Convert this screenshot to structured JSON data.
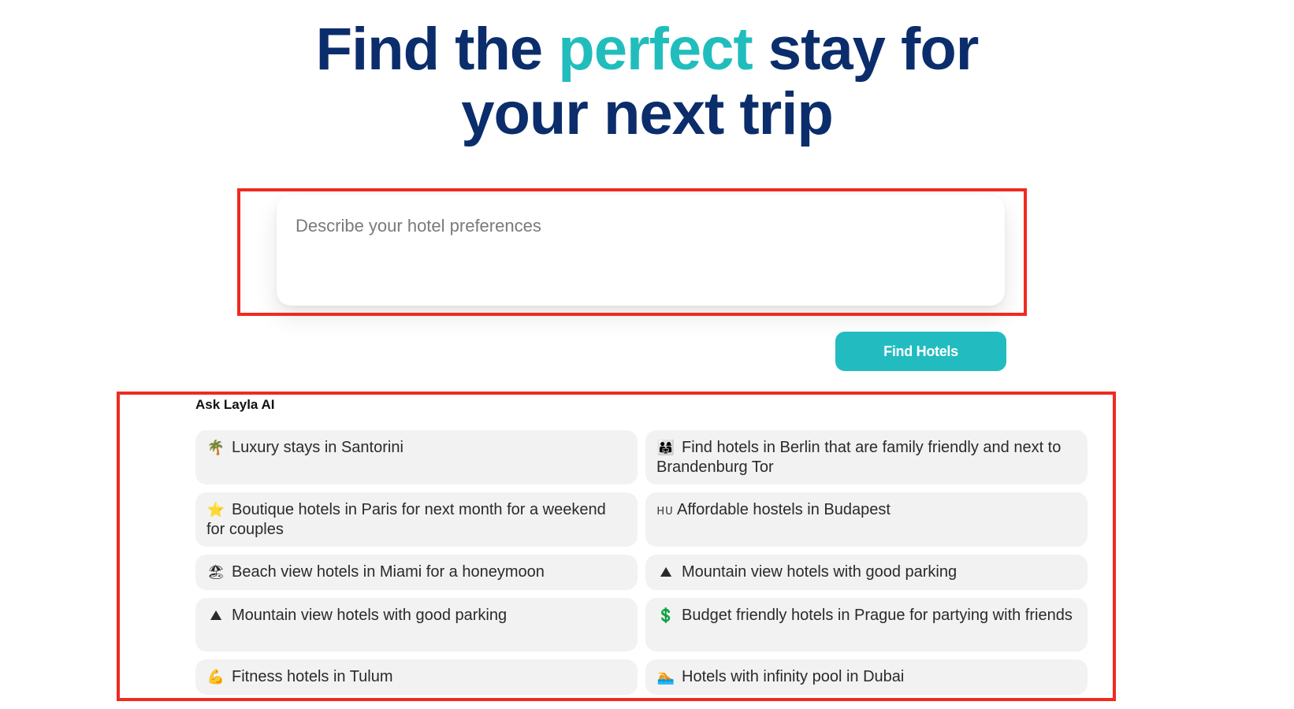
{
  "hero": {
    "line1_pre": "Find the ",
    "line1_accent": "perfect",
    "line1_post": " stay for",
    "line2": "your next trip"
  },
  "search": {
    "placeholder": "Describe your hotel preferences",
    "value": ""
  },
  "find_button": {
    "label": "Find Hotels"
  },
  "suggestions": {
    "label": "Ask Layla AI",
    "items": [
      {
        "icon": "🌴",
        "icon_name": "palm-tree-icon",
        "text": "Luxury stays in Santorini"
      },
      {
        "icon": "👨‍👩‍👧",
        "icon_name": "family-icon",
        "text": "Find hotels in Berlin that are family friendly and next to Brandenburg Tor"
      },
      {
        "icon": "⭐",
        "icon_name": "star-icon",
        "text": "Boutique hotels in Paris for next month for a weekend for couples"
      },
      {
        "icon": "HU",
        "icon_name": "hungary-flag-icon",
        "text": "Affordable hostels in Budapest"
      },
      {
        "icon": "🏖",
        "icon_name": "beach-icon",
        "text": "Beach view hotels in Miami for a honeymoon"
      },
      {
        "icon": "⛰",
        "icon_name": "mountain-icon",
        "text": "Mountain view hotels with good parking"
      },
      {
        "icon": "⛰",
        "icon_name": "mountain-icon",
        "text": "Mountain view hotels with good parking"
      },
      {
        "icon": "💲",
        "icon_name": "dollar-icon",
        "text": "Budget friendly hotels in Prague for partying with friends"
      },
      {
        "icon": "💪",
        "icon_name": "flexed-biceps-icon",
        "text": "Fitness hotels in Tulum"
      },
      {
        "icon": "🏊",
        "icon_name": "swimming-icon",
        "text": "Hotels with infinity pool in Dubai"
      }
    ]
  },
  "colors": {
    "title": "#0b2d6b",
    "accent": "#21bdbd",
    "button": "#22bcc0",
    "highlight": "#f02a1f",
    "chip_bg": "#f2f2f2"
  }
}
